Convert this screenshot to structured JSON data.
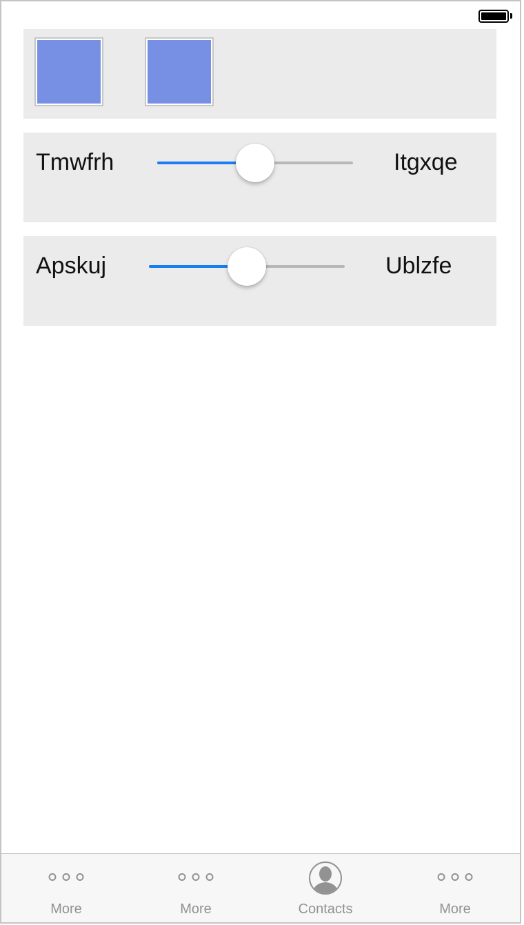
{
  "slider_rows": [
    {
      "left_label": "Tmwfrh",
      "right_label": "Itgxqe",
      "value": 0.5
    },
    {
      "left_label": "Apskuj",
      "right_label": "Ublzfe",
      "value": 0.5
    }
  ],
  "image_tiles": [
    {
      "color": "#7890e4"
    },
    {
      "color": "#7890e4"
    }
  ],
  "tab_bar": {
    "tabs": [
      {
        "label": "More",
        "icon": "more-dots-icon"
      },
      {
        "label": "More",
        "icon": "more-dots-icon"
      },
      {
        "label": "Contacts",
        "icon": "contact-person-icon"
      },
      {
        "label": "More",
        "icon": "more-dots-icon"
      }
    ]
  },
  "colors": {
    "accent": "#1a7cf0",
    "panel_background": "#ebebeb",
    "tile_fill": "#7890e4",
    "tab_inactive": "#929292"
  }
}
